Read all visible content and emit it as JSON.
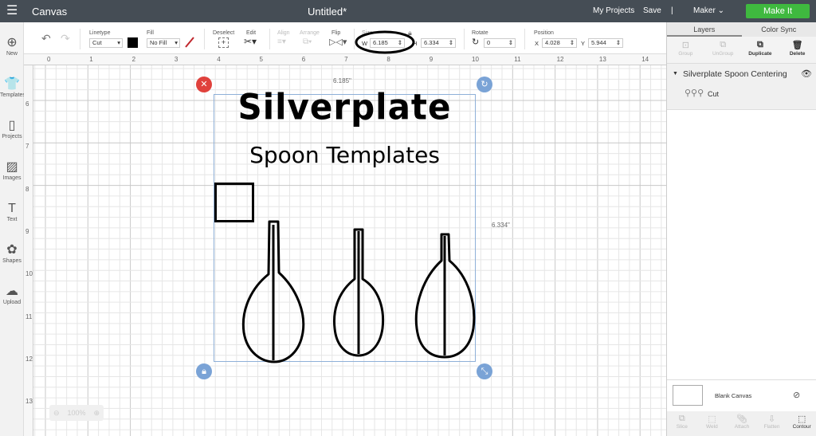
{
  "topbar": {
    "menu_icon": "hamburger-icon",
    "app": "Canvas",
    "title": "Untitled*",
    "my_projects": "My Projects",
    "save": "Save",
    "divider": "|",
    "machine": "Maker",
    "make_it": "Make It",
    "accent": "#3fb93f"
  },
  "sidebar": [
    {
      "label": "New",
      "icon": "plus-circle-icon"
    },
    {
      "label": "Templates",
      "icon": "shirt-icon"
    },
    {
      "label": "Projects",
      "icon": "book-icon"
    },
    {
      "label": "Images",
      "icon": "image-icon"
    },
    {
      "label": "Text",
      "icon": "text-icon"
    },
    {
      "label": "Shapes",
      "icon": "shapes-icon"
    },
    {
      "label": "Upload",
      "icon": "cloud-upload-icon"
    }
  ],
  "toolbar": {
    "linetype_label": "Linetype",
    "linetype": "Cut",
    "fill_label": "Fill",
    "fill": "No Fill",
    "deselect": "Deselect",
    "edit": "Edit",
    "align": "Align",
    "arrange": "Arrange",
    "flip": "Flip",
    "size": "Size",
    "w_label": "W",
    "w": "6.185",
    "h_label": "H",
    "h": "6.334",
    "rotate": "Rotate",
    "rotate_value": "0",
    "position": "Position",
    "x_label": "X",
    "x": "4.028",
    "y_label": "Y",
    "y": "5.944"
  },
  "ruler": {
    "h": [
      "0",
      "1",
      "2",
      "3",
      "4",
      "5",
      "6",
      "7",
      "8",
      "9",
      "10",
      "11",
      "12",
      "13",
      "14"
    ],
    "v": [
      "6",
      "7",
      "8",
      "9",
      "10",
      "11",
      "12",
      "13"
    ]
  },
  "canvas": {
    "width_dim": "6.185\"",
    "height_dim": "6.334\"",
    "art_line1": "Silverplate",
    "art_line2": "Spoon Templates",
    "zoom": "100%"
  },
  "panel": {
    "tabs": [
      "Layers",
      "Color Sync"
    ],
    "actions": [
      "Group",
      "UnGroup",
      "Duplicate",
      "Delete"
    ],
    "layer_group": "Silverplate Spoon Centering",
    "layer_item": "Cut",
    "blank_canvas": "Blank Canvas",
    "bottom": [
      "Slice",
      "Weld",
      "Attach",
      "Flatten",
      "Contour"
    ]
  }
}
